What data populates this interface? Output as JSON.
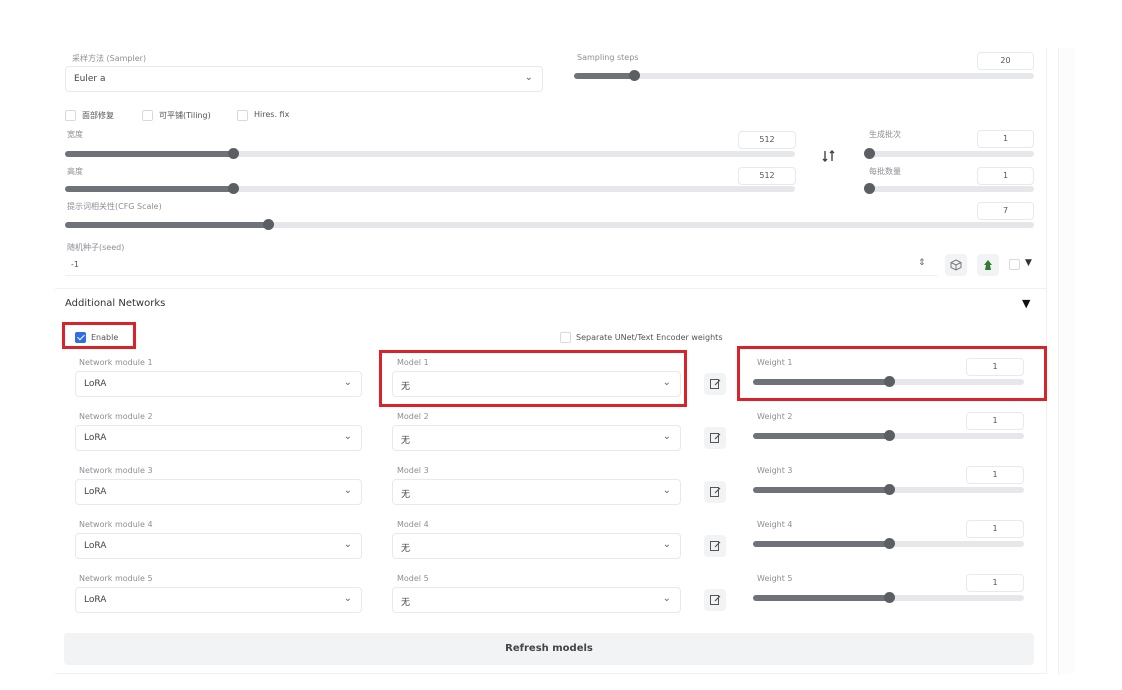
{
  "sampler": {
    "label": "采样方法 (Sampler)",
    "value": "Euler a"
  },
  "steps": {
    "label": "Sampling steps",
    "value": "20",
    "fraction": 0.13
  },
  "checkboxes": [
    {
      "label": "面部修复",
      "checked": false
    },
    {
      "label": "可平铺(Tiling)",
      "checked": false
    },
    {
      "label": "Hires. fix",
      "checked": false
    }
  ],
  "width": {
    "label": "宽度",
    "value": "512",
    "fraction": 0.23
  },
  "height": {
    "label": "高度",
    "value": "512",
    "fraction": 0.23
  },
  "swap_icon": "swap-icon",
  "batch_count": {
    "label": "生成批次",
    "value": "1",
    "fraction": 0.0
  },
  "batch_size": {
    "label": "每批数量",
    "value": "1",
    "fraction": 0.0
  },
  "cfg": {
    "label": "提示词相关性(CFG Scale)",
    "value": "7",
    "fraction": 0.21
  },
  "seed": {
    "label": "随机种子(seed)",
    "value": "-1"
  },
  "seed_icons": [
    "stepper-icon",
    "dice-icon",
    "recycle-icon"
  ],
  "additional": {
    "title": "Additional Networks",
    "enable_label": "Enable",
    "enable_checked": true,
    "separate_label": "Separate UNet/Text Encoder weights",
    "separate_checked": false,
    "rows": [
      {
        "module_label": "Network module 1",
        "module_value": "LoRA",
        "model_label": "Model 1",
        "model_value": "无",
        "weight_label": "Weight 1",
        "weight_value": "1",
        "weight_fraction": 0.5
      },
      {
        "module_label": "Network module 2",
        "module_value": "LoRA",
        "model_label": "Model 2",
        "model_value": "无",
        "weight_label": "Weight 2",
        "weight_value": "1",
        "weight_fraction": 0.5
      },
      {
        "module_label": "Network module 3",
        "module_value": "LoRA",
        "model_label": "Model 3",
        "model_value": "无",
        "weight_label": "Weight 3",
        "weight_value": "1",
        "weight_fraction": 0.5
      },
      {
        "module_label": "Network module 4",
        "module_value": "LoRA",
        "model_label": "Model 4",
        "model_value": "无",
        "weight_label": "Weight 4",
        "weight_value": "1",
        "weight_fraction": 0.5
      },
      {
        "module_label": "Network module 5",
        "module_value": "LoRA",
        "model_label": "Model 5",
        "model_value": "无",
        "weight_label": "Weight 5",
        "weight_value": "1",
        "weight_fraction": 0.5
      }
    ],
    "refresh_label": "Refresh models"
  },
  "colors": {
    "highlight": "#d9232a",
    "checkbox": "#2f6fe4",
    "slider": "#6f7278"
  }
}
